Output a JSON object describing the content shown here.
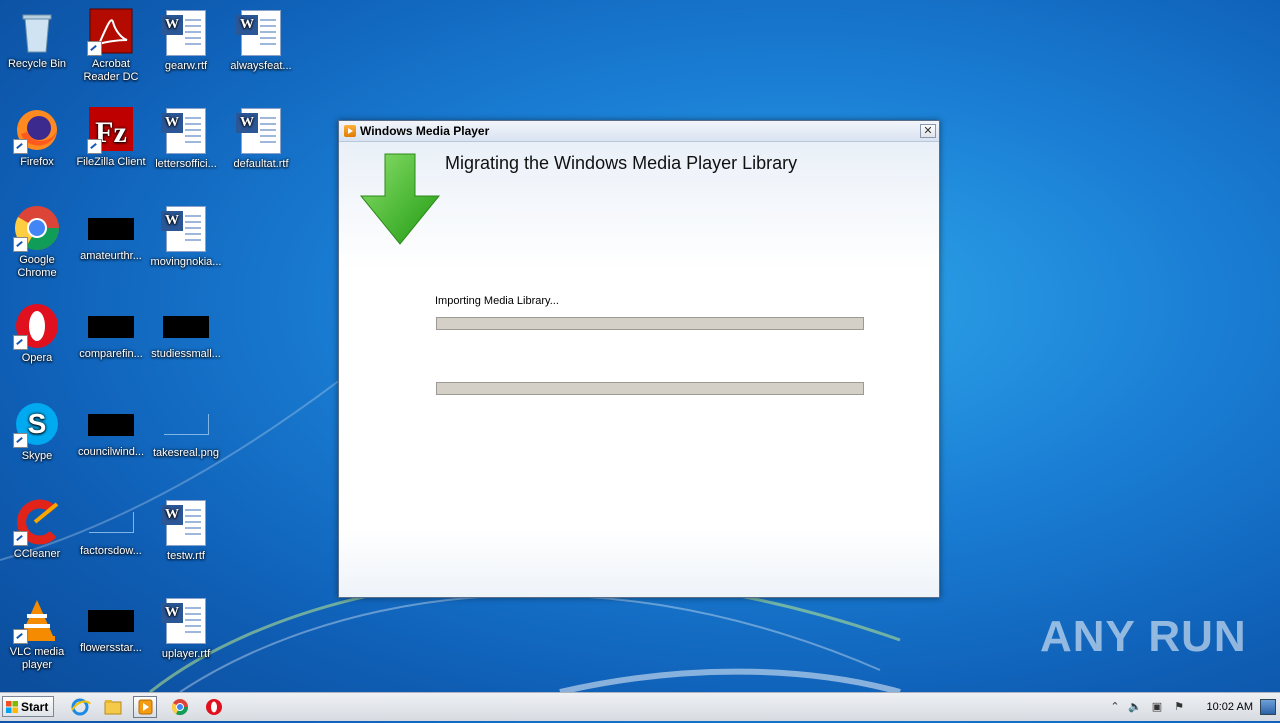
{
  "desktop": {
    "icons": [
      {
        "label": "Recycle Bin",
        "name": "recycle-bin-icon"
      },
      {
        "label": "Acrobat Reader DC",
        "name": "acrobat-reader-icon"
      },
      {
        "label": "gearw.rtf",
        "name": "word-document-icon"
      },
      {
        "label": "alwaysfeat...",
        "name": "word-document-icon"
      },
      {
        "label": "Firefox",
        "name": "firefox-icon"
      },
      {
        "label": "FileZilla Client",
        "name": "filezilla-icon"
      },
      {
        "label": "lettersoffici...",
        "name": "word-document-icon"
      },
      {
        "label": "defaultat.rtf",
        "name": "word-document-icon"
      },
      {
        "label": "Google Chrome",
        "name": "chrome-icon"
      },
      {
        "label": "amateurthr...",
        "name": "image-thumbnail-icon"
      },
      {
        "label": "movingnokia...",
        "name": "word-document-icon"
      },
      {
        "label": "Opera",
        "name": "opera-icon"
      },
      {
        "label": "comparefin...",
        "name": "image-thumbnail-icon"
      },
      {
        "label": "studiessmall...",
        "name": "image-thumbnail-icon"
      },
      {
        "label": "Skype",
        "name": "skype-icon"
      },
      {
        "label": "councilwind...",
        "name": "image-thumbnail-icon"
      },
      {
        "label": "takesreal.png",
        "name": "image-thumbnail-icon"
      },
      {
        "label": "CCleaner",
        "name": "ccleaner-icon"
      },
      {
        "label": "factorsdow...",
        "name": "image-thumbnail-icon"
      },
      {
        "label": "testw.rtf",
        "name": "word-document-icon"
      },
      {
        "label": "VLC media player",
        "name": "vlc-icon"
      },
      {
        "label": "flowersstar...",
        "name": "image-thumbnail-icon"
      },
      {
        "label": "uplayer.rtf",
        "name": "word-document-icon"
      }
    ]
  },
  "dialog": {
    "title": "Windows Media Player",
    "close_label": "✕",
    "heading": "Migrating the Windows Media Player Library",
    "status": "Importing Media Library...",
    "progress_1": 0,
    "progress_2": 0
  },
  "watermark": "ANY RUN",
  "taskbar": {
    "start_label": "Start",
    "pinned": [
      {
        "name": "internet-explorer-icon"
      },
      {
        "name": "file-explorer-icon"
      },
      {
        "name": "windows-media-player-icon",
        "active": true
      },
      {
        "name": "chrome-icon"
      },
      {
        "name": "opera-icon"
      }
    ],
    "clock": "10:02 AM"
  },
  "colors": {
    "desktop_bg": "#1a7ed4",
    "progress_track": "#d4d0c8",
    "arrow_green": "#3cb521"
  }
}
